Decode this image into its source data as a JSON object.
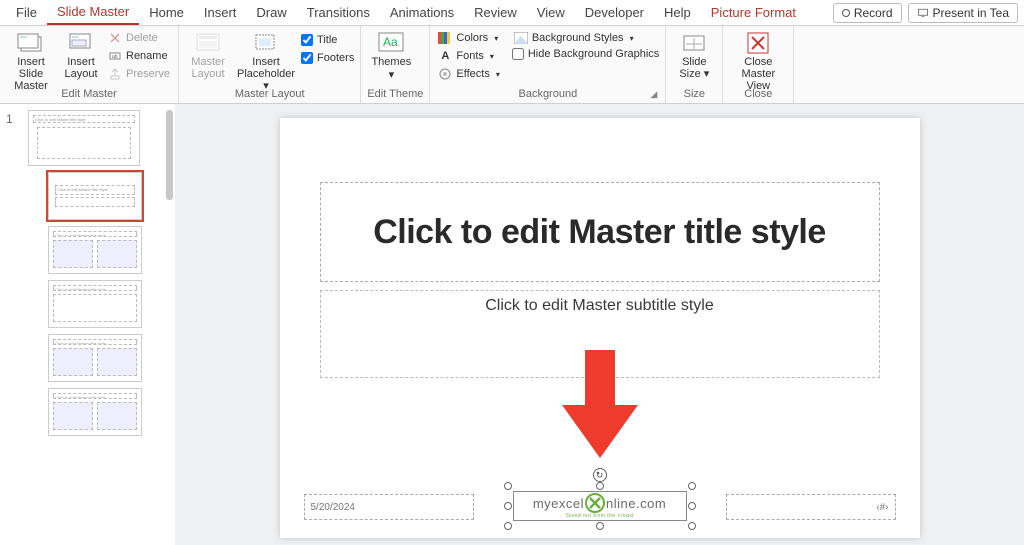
{
  "tabs": {
    "file": "File",
    "slide_master": "Slide Master",
    "home": "Home",
    "insert": "Insert",
    "draw": "Draw",
    "transitions": "Transitions",
    "animations": "Animations",
    "review": "Review",
    "view": "View",
    "developer": "Developer",
    "help": "Help",
    "picture_format": "Picture Format"
  },
  "top_right": {
    "record": "Record",
    "present": "Present in Tea"
  },
  "ribbon": {
    "edit_master": {
      "label": "Edit Master",
      "insert_slide_master": "Insert Slide\nMaster",
      "insert_layout": "Insert\nLayout",
      "delete": "Delete",
      "rename": "Rename",
      "preserve": "Preserve"
    },
    "master_layout": {
      "label": "Master Layout",
      "master_layout_btn": "Master\nLayout",
      "insert_placeholder": "Insert\nPlaceholder",
      "title_chk": "Title",
      "footers_chk": "Footers"
    },
    "edit_theme": {
      "label": "Edit Theme",
      "themes": "Themes"
    },
    "background": {
      "label": "Background",
      "colors": "Colors",
      "fonts": "Fonts",
      "effects": "Effects",
      "bg_styles": "Background Styles",
      "hide_bg": "Hide Background Graphics"
    },
    "size": {
      "label": "Size",
      "slide_size": "Slide\nSize"
    },
    "close": {
      "label": "Close",
      "close_master": "Close\nMaster View"
    }
  },
  "thumbs": {
    "number": "1",
    "master_title": "Click to edit Master title style",
    "layout_title": "Click to edit Master title style"
  },
  "slide": {
    "title": "Click to edit Master title style",
    "subtitle": "Click to edit Master subtitle style",
    "date": "5/20/2024",
    "footer_number": "‹#›",
    "logo_main_pre": "myexcel",
    "logo_main_post": "nline.com",
    "logo_sub": "Stand out from the crowd"
  }
}
